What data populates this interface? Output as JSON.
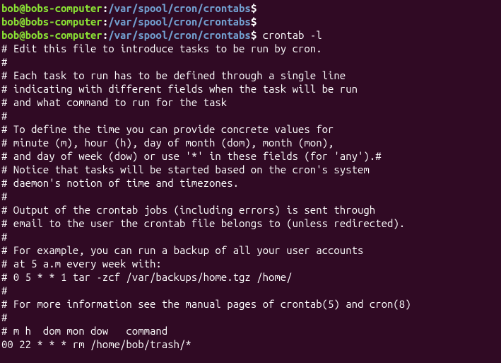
{
  "prompts": [
    {
      "user": "bob@bobs-computer",
      "colon": ":",
      "path": "/var/spool/cron/crontabs",
      "dollar": "$",
      "command": ""
    },
    {
      "user": "bob@bobs-computer",
      "colon": ":",
      "path": "/var/spool/cron/crontabs",
      "dollar": "$",
      "command": ""
    },
    {
      "user": "bob@bobs-computer",
      "colon": ":",
      "path": "/var/spool/cron/crontabs",
      "dollar": "$",
      "command": " crontab -l"
    }
  ],
  "output_lines": [
    "# Edit this file to introduce tasks to be run by cron.",
    "#",
    "# Each task to run has to be defined through a single line",
    "# indicating with different fields when the task will be run",
    "# and what command to run for the task",
    "#",
    "# To define the time you can provide concrete values for",
    "# minute (m), hour (h), day of month (dom), month (mon),",
    "# and day of week (dow) or use '*' in these fields (for 'any').#",
    "# Notice that tasks will be started based on the cron's system",
    "# daemon's notion of time and timezones.",
    "#",
    "# Output of the crontab jobs (including errors) is sent through",
    "# email to the user the crontab file belongs to (unless redirected).",
    "#",
    "# For example, you can run a backup of all your user accounts",
    "# at 5 a.m every week with:",
    "# 0 5 * * 1 tar -zcf /var/backups/home.tgz /home/",
    "#",
    "# For more information see the manual pages of crontab(5) and cron(8)",
    "#",
    "# m h  dom mon dow   command",
    "",
    "00 22 * * * rm /home/bob/trash/*"
  ]
}
